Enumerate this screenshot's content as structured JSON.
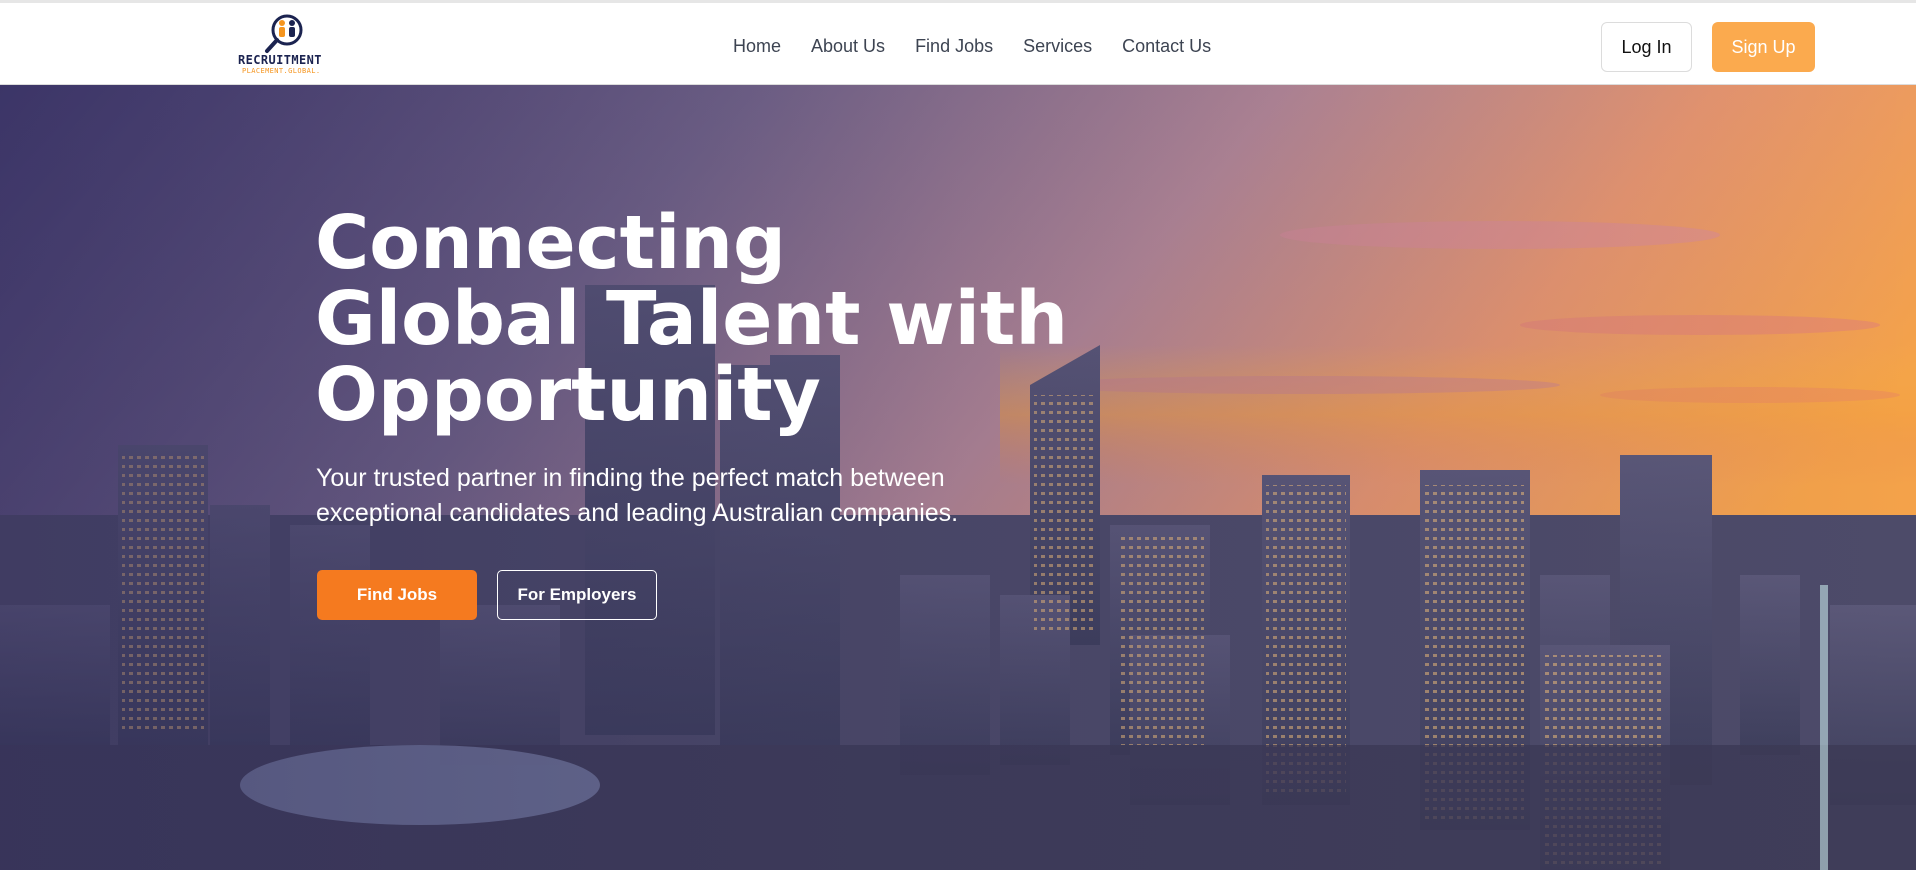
{
  "brand": {
    "name": "RECRUITMENT",
    "tagline": "PLACEMENT.GLOBAL.",
    "logo_icon": "magnifier-people-icon",
    "colors": {
      "navy": "#1b2350",
      "orange": "#f5951f"
    }
  },
  "nav": {
    "links": [
      {
        "label": "Home"
      },
      {
        "label": "About Us"
      },
      {
        "label": "Find Jobs"
      },
      {
        "label": "Services"
      },
      {
        "label": "Contact Us"
      }
    ],
    "login_label": "Log In",
    "signup_label": "Sign Up"
  },
  "hero": {
    "title_lines": [
      "Connecting",
      "Global Talent with",
      "Opportunity"
    ],
    "subtitle_lines": [
      "Your trusted partner in finding the perfect match between",
      "exceptional candidates and leading Australian companies."
    ],
    "primary_cta": "Find Jobs",
    "secondary_cta": "For Employers",
    "background": "city-skyline-sunset",
    "colors": {
      "accent": "#f57a1f",
      "signup": "#fbaa4e"
    }
  }
}
